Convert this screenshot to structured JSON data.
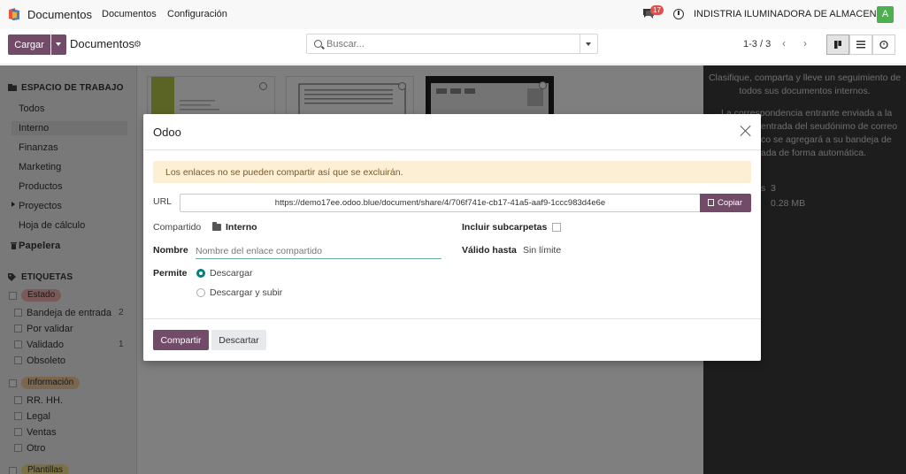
{
  "navbar": {
    "app_name": "Documentos",
    "menu": [
      "Documentos",
      "Configuración"
    ],
    "chat_badge": "17",
    "company": "INDISTRIA ILUMINADORA DE ALMACENES",
    "avatar_letter": "A"
  },
  "control": {
    "upload_label": "Cargar",
    "breadcrumb": "Documentos",
    "search_placeholder": "Buscar...",
    "pager": "1-3 / 3"
  },
  "sidebar": {
    "workspace_heading": "ESPACIO DE TRABAJO",
    "workspaces": [
      "Todos",
      "Interno",
      "Finanzas",
      "Marketing",
      "Productos",
      "Proyectos",
      "Hoja de cálculo"
    ],
    "trash": "Papelera",
    "tags_heading": "ETIQUETAS",
    "tag_groups": [
      {
        "name": "Estado",
        "color": "#f4b3b3",
        "tags": [
          {
            "label": "Bandeja de entrada",
            "count": "2"
          },
          {
            "label": "Por validar",
            "count": ""
          },
          {
            "label": "Validado",
            "count": "1"
          },
          {
            "label": "Obsoleto",
            "count": ""
          }
        ]
      },
      {
        "name": "Información",
        "color": "#f7cd9c",
        "tags": [
          {
            "label": "RR. HH.",
            "count": ""
          },
          {
            "label": "Legal",
            "count": ""
          },
          {
            "label": "Ventas",
            "count": ""
          },
          {
            "label": "Otro",
            "count": ""
          }
        ]
      },
      {
        "name": "Plantillas",
        "color": "#f5e38c",
        "tags": []
      }
    ]
  },
  "right_panel": {
    "intro": [
      "Clasifique, comparta y lleve un seguimiento de",
      "todos sus documentos internos."
    ],
    "partial_lines": [
      "La correspondencia entrante enviada a la",
      "entrada del seudónimo de correo",
      "co se agregará a su bandeja de",
      "ada de forma automática."
    ],
    "stat_count_label": "s",
    "stat_count": "3",
    "stat_size": "0.28 MB"
  },
  "modal": {
    "title": "Odoo",
    "warning": "Los enlaces no se pueden compartir así que se excluirán.",
    "url_label": "URL",
    "url_value": "https://demo17ee.odoo.blue/document/share/4/706f741e-cb17-41a5-aaf9-1ccc983d4e6e",
    "copy_label": "Copiar",
    "shared_label": "Compartido",
    "shared_value": "Interno",
    "include_sub_label": "Incluir subcarpetas",
    "name_label": "Nombre",
    "name_placeholder": "Nombre del enlace compartido",
    "valid_until_label": "Válido hasta",
    "valid_until_value": "Sin límite",
    "permit_label": "Permite",
    "permit_options": [
      "Descargar",
      "Descargar y subir"
    ],
    "share_button": "Compartir",
    "discard_button": "Descartar"
  },
  "colors": {
    "brand": "#714b67",
    "accent": "#017e84",
    "warning_bg": "#fcefd3"
  }
}
